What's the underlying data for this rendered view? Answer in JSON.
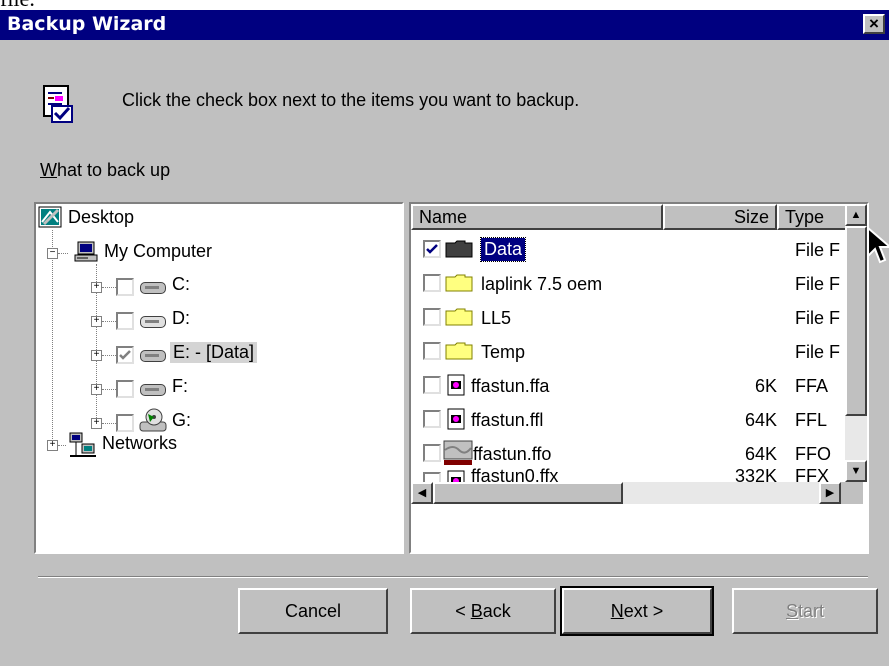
{
  "top_fragment": "file.",
  "window": {
    "title": "Backup Wizard",
    "close_glyph": "×"
  },
  "instruction": "Click the check box next to the items you want to backup.",
  "what_label": "What to back up",
  "tree": {
    "desktop": "Desktop",
    "my_computer": "My Computer",
    "drives": [
      {
        "label": "C:",
        "checked": false
      },
      {
        "label": "D:",
        "checked": false
      },
      {
        "label": "E: - [Data]",
        "checked": true,
        "selected": true
      },
      {
        "label": "F:",
        "checked": false
      },
      {
        "label": "G:",
        "checked": false
      }
    ],
    "networks": "Networks"
  },
  "list": {
    "headers": {
      "name": "Name",
      "size": "Size",
      "type": "Type"
    },
    "rows": [
      {
        "name": "Data",
        "size": "",
        "type": "File F",
        "checked": true,
        "icon": "folder-dark-icon"
      },
      {
        "name": "laplink 7.5 oem",
        "size": "",
        "type": "File F",
        "checked": false,
        "icon": "folder-icon"
      },
      {
        "name": "LL5",
        "size": "",
        "type": "File F",
        "checked": false,
        "icon": "folder-icon"
      },
      {
        "name": "Temp",
        "size": "",
        "type": "File F",
        "checked": false,
        "icon": "folder-icon"
      },
      {
        "name": "ffastun.ffa",
        "size": "6K",
        "type": "FFA",
        "checked": false,
        "icon": "file-icon"
      },
      {
        "name": "ffastun.ffl",
        "size": "64K",
        "type": "FFL",
        "checked": false,
        "icon": "file-icon"
      },
      {
        "name": "ffastun.ffo",
        "size": "64K",
        "type": "FFO",
        "checked": false,
        "icon": "image-file-icon"
      },
      {
        "name": "ffastun0.ffx",
        "size": "332K",
        "type": "FFX",
        "checked": false,
        "icon": "file-icon"
      }
    ]
  },
  "buttons": {
    "cancel": "Cancel",
    "back": "< Back",
    "next": "Next >",
    "start": "Start"
  }
}
